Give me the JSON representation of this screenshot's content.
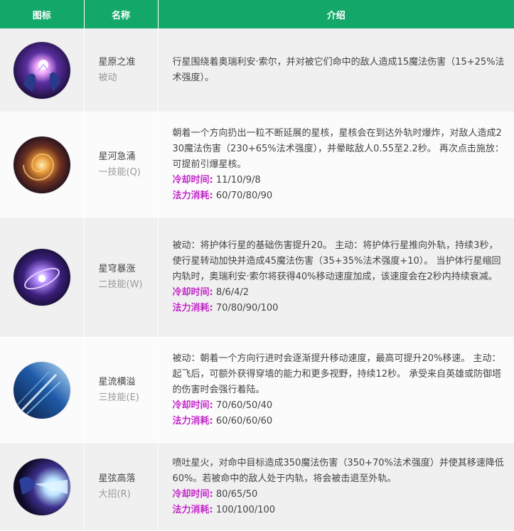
{
  "header": {
    "icon": "图标",
    "name": "名称",
    "desc": "介绍"
  },
  "labels": {
    "cooldown": "冷却时间:",
    "mana": "法力消耗:"
  },
  "skills": [
    {
      "name": "星原之准",
      "type": "被动",
      "icon": "star-hands-icon",
      "desc": "行星围绕着奥瑞利安·索尔，并对被它们命中的敌人造成15魔法伤害（15+25%法术强度）。",
      "cooldown": "",
      "mana": ""
    },
    {
      "name": "星河急涌",
      "type": "一技能(Q)",
      "icon": "galaxy-icon",
      "desc": "朝着一个方向扔出一粒不断延展的星核，星核会在到达外轨时爆炸，对敌人造成230魔法伤害（230+65%法术强度），并晕眩敌人0.55至2.2秒。 再次点击施放：可提前引爆星核。",
      "cooldown": "11/10/9/8",
      "mana": "60/70/80/90"
    },
    {
      "name": "星穹暴涨",
      "type": "二技能(W)",
      "icon": "star-orbit-icon",
      "desc": "被动：将护体行星的基础伤害提升20。 主动：将护体行星推向外轨，持续3秒，使行星转动加快并造成45魔法伤害（35+35%法术强度+10）。 当护体行星缩回内轨时，奥瑞利安·索尔将获得40%移动速度加成，该速度会在2秒内持续衰减。",
      "cooldown": "8/6/4/2",
      "mana": "70/80/90/100"
    },
    {
      "name": "星流横溢",
      "type": "三技能(E)",
      "icon": "comet-flight-icon",
      "desc": "被动：朝着一个方向行进时会逐渐提升移动速度，最高可提升20%移速。 主动：起飞后，可额外获得穿墙的能力和更多视野，持续12秒。 承受来自英雄或防御塔的伤害时会强行着陆。",
      "cooldown": "70/60/50/40",
      "mana": "60/60/60/60"
    },
    {
      "name": "星弦高落",
      "type": "大招(R)",
      "icon": "starfire-breath-icon",
      "desc": "喷吐星火，对命中目标造成350魔法伤害（350+70%法术强度）并使其移速降低60%。若被命中的敌人处于内轨，将会被击退至外轨。",
      "cooldown": "80/65/50",
      "mana": "100/100/100"
    }
  ],
  "colors": {
    "header_bg": "#13a86a",
    "label": "#c327c9",
    "row_odd": "#f0f0f0",
    "row_even": "#fbfbfb"
  }
}
